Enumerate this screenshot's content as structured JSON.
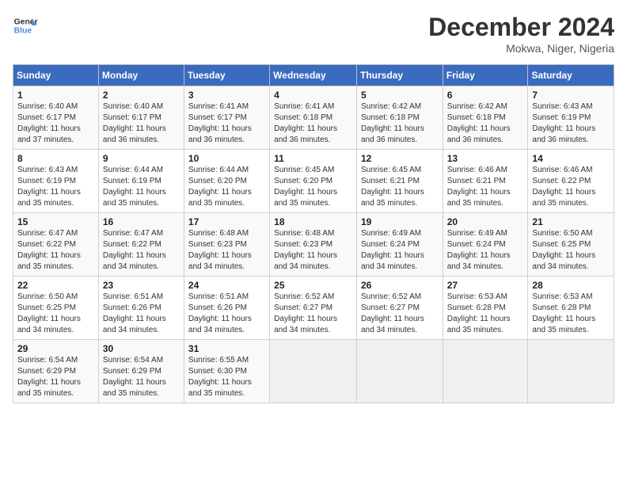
{
  "header": {
    "logo_line1": "General",
    "logo_line2": "Blue",
    "main_title": "December 2024",
    "subtitle": "Mokwa, Niger, Nigeria"
  },
  "calendar": {
    "days_of_week": [
      "Sunday",
      "Monday",
      "Tuesday",
      "Wednesday",
      "Thursday",
      "Friday",
      "Saturday"
    ],
    "weeks": [
      [
        {
          "day": "1",
          "info": "Sunrise: 6:40 AM\nSunset: 6:17 PM\nDaylight: 11 hours and 37 minutes."
        },
        {
          "day": "2",
          "info": "Sunrise: 6:40 AM\nSunset: 6:17 PM\nDaylight: 11 hours and 36 minutes."
        },
        {
          "day": "3",
          "info": "Sunrise: 6:41 AM\nSunset: 6:17 PM\nDaylight: 11 hours and 36 minutes."
        },
        {
          "day": "4",
          "info": "Sunrise: 6:41 AM\nSunset: 6:18 PM\nDaylight: 11 hours and 36 minutes."
        },
        {
          "day": "5",
          "info": "Sunrise: 6:42 AM\nSunset: 6:18 PM\nDaylight: 11 hours and 36 minutes."
        },
        {
          "day": "6",
          "info": "Sunrise: 6:42 AM\nSunset: 6:18 PM\nDaylight: 11 hours and 36 minutes."
        },
        {
          "day": "7",
          "info": "Sunrise: 6:43 AM\nSunset: 6:19 PM\nDaylight: 11 hours and 36 minutes."
        }
      ],
      [
        {
          "day": "8",
          "info": "Sunrise: 6:43 AM\nSunset: 6:19 PM\nDaylight: 11 hours and 35 minutes."
        },
        {
          "day": "9",
          "info": "Sunrise: 6:44 AM\nSunset: 6:19 PM\nDaylight: 11 hours and 35 minutes."
        },
        {
          "day": "10",
          "info": "Sunrise: 6:44 AM\nSunset: 6:20 PM\nDaylight: 11 hours and 35 minutes."
        },
        {
          "day": "11",
          "info": "Sunrise: 6:45 AM\nSunset: 6:20 PM\nDaylight: 11 hours and 35 minutes."
        },
        {
          "day": "12",
          "info": "Sunrise: 6:45 AM\nSunset: 6:21 PM\nDaylight: 11 hours and 35 minutes."
        },
        {
          "day": "13",
          "info": "Sunrise: 6:46 AM\nSunset: 6:21 PM\nDaylight: 11 hours and 35 minutes."
        },
        {
          "day": "14",
          "info": "Sunrise: 6:46 AM\nSunset: 6:22 PM\nDaylight: 11 hours and 35 minutes."
        }
      ],
      [
        {
          "day": "15",
          "info": "Sunrise: 6:47 AM\nSunset: 6:22 PM\nDaylight: 11 hours and 35 minutes."
        },
        {
          "day": "16",
          "info": "Sunrise: 6:47 AM\nSunset: 6:22 PM\nDaylight: 11 hours and 34 minutes."
        },
        {
          "day": "17",
          "info": "Sunrise: 6:48 AM\nSunset: 6:23 PM\nDaylight: 11 hours and 34 minutes."
        },
        {
          "day": "18",
          "info": "Sunrise: 6:48 AM\nSunset: 6:23 PM\nDaylight: 11 hours and 34 minutes."
        },
        {
          "day": "19",
          "info": "Sunrise: 6:49 AM\nSunset: 6:24 PM\nDaylight: 11 hours and 34 minutes."
        },
        {
          "day": "20",
          "info": "Sunrise: 6:49 AM\nSunset: 6:24 PM\nDaylight: 11 hours and 34 minutes."
        },
        {
          "day": "21",
          "info": "Sunrise: 6:50 AM\nSunset: 6:25 PM\nDaylight: 11 hours and 34 minutes."
        }
      ],
      [
        {
          "day": "22",
          "info": "Sunrise: 6:50 AM\nSunset: 6:25 PM\nDaylight: 11 hours and 34 minutes."
        },
        {
          "day": "23",
          "info": "Sunrise: 6:51 AM\nSunset: 6:26 PM\nDaylight: 11 hours and 34 minutes."
        },
        {
          "day": "24",
          "info": "Sunrise: 6:51 AM\nSunset: 6:26 PM\nDaylight: 11 hours and 34 minutes."
        },
        {
          "day": "25",
          "info": "Sunrise: 6:52 AM\nSunset: 6:27 PM\nDaylight: 11 hours and 34 minutes."
        },
        {
          "day": "26",
          "info": "Sunrise: 6:52 AM\nSunset: 6:27 PM\nDaylight: 11 hours and 34 minutes."
        },
        {
          "day": "27",
          "info": "Sunrise: 6:53 AM\nSunset: 6:28 PM\nDaylight: 11 hours and 35 minutes."
        },
        {
          "day": "28",
          "info": "Sunrise: 6:53 AM\nSunset: 6:28 PM\nDaylight: 11 hours and 35 minutes."
        }
      ],
      [
        {
          "day": "29",
          "info": "Sunrise: 6:54 AM\nSunset: 6:29 PM\nDaylight: 11 hours and 35 minutes."
        },
        {
          "day": "30",
          "info": "Sunrise: 6:54 AM\nSunset: 6:29 PM\nDaylight: 11 hours and 35 minutes."
        },
        {
          "day": "31",
          "info": "Sunrise: 6:55 AM\nSunset: 6:30 PM\nDaylight: 11 hours and 35 minutes."
        },
        null,
        null,
        null,
        null
      ]
    ]
  }
}
